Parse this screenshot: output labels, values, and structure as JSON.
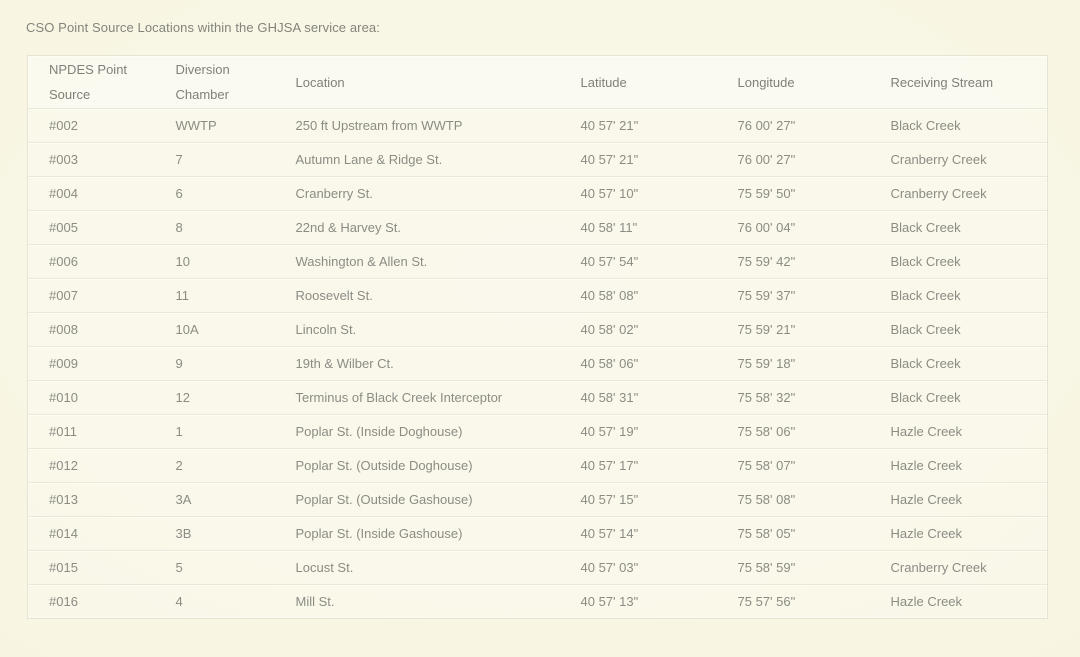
{
  "page": {
    "title": "CSO Point Source Locations within the GHJSA service area:"
  },
  "table": {
    "columns": [
      {
        "label": "NPDES Point Source"
      },
      {
        "label": "Diversion Chamber"
      },
      {
        "label": "Location"
      },
      {
        "label": "Latitude"
      },
      {
        "label": "Longitude"
      },
      {
        "label": "Receiving Stream"
      }
    ],
    "rows": [
      {
        "npdes": "#002",
        "chamber": "WWTP",
        "location": "250 ft Upstream from WWTP",
        "latitude": "40 57' 21\"",
        "longitude": "76 00' 27\"",
        "stream": "Black Creek"
      },
      {
        "npdes": "#003",
        "chamber": "7",
        "location": "Autumn Lane & Ridge St.",
        "latitude": "40 57' 21\"",
        "longitude": "76 00' 27\"",
        "stream": "Cranberry Creek"
      },
      {
        "npdes": "#004",
        "chamber": "6",
        "location": "Cranberry St.",
        "latitude": "40 57' 10\"",
        "longitude": "75 59' 50\"",
        "stream": "Cranberry Creek"
      },
      {
        "npdes": "#005",
        "chamber": "8",
        "location": "22nd & Harvey St.",
        "latitude": "40 58' 11\"",
        "longitude": "76 00' 04\"",
        "stream": "Black Creek"
      },
      {
        "npdes": "#006",
        "chamber": "10",
        "location": "Washington & Allen St.",
        "latitude": "40 57' 54\"",
        "longitude": "75 59' 42\"",
        "stream": "Black Creek"
      },
      {
        "npdes": "#007",
        "chamber": "11",
        "location": "Roosevelt St.",
        "latitude": "40 58' 08\"",
        "longitude": "75 59' 37\"",
        "stream": "Black Creek"
      },
      {
        "npdes": "#008",
        "chamber": "10A",
        "location": "Lincoln St.",
        "latitude": "40 58' 02\"",
        "longitude": "75 59' 21\"",
        "stream": "Black Creek"
      },
      {
        "npdes": "#009",
        "chamber": "9",
        "location": "19th & Wilber Ct.",
        "latitude": "40 58' 06\"",
        "longitude": "75 59' 18\"",
        "stream": "Black Creek"
      },
      {
        "npdes": "#010",
        "chamber": "12",
        "location": "Terminus of Black Creek Interceptor",
        "latitude": "40 58' 31\"",
        "longitude": "75 58' 32\"",
        "stream": "Black Creek"
      },
      {
        "npdes": "#011",
        "chamber": "1",
        "location": "Poplar St. (Inside Doghouse)",
        "latitude": "40 57' 19\"",
        "longitude": "75 58' 06\"",
        "stream": "Hazle Creek"
      },
      {
        "npdes": "#012",
        "chamber": "2",
        "location": "Poplar St. (Outside Doghouse)",
        "latitude": "40 57' 17\"",
        "longitude": "75 58' 07\"",
        "stream": "Hazle Creek"
      },
      {
        "npdes": "#013",
        "chamber": "3A",
        "location": "Poplar St. (Outside Gashouse)",
        "latitude": "40 57' 15\"",
        "longitude": "75 58' 08\"",
        "stream": "Hazle Creek"
      },
      {
        "npdes": "#014",
        "chamber": "3B",
        "location": "Poplar St. (Inside Gashouse)",
        "latitude": "40 57' 14\"",
        "longitude": "75 58' 05\"",
        "stream": "Hazle Creek"
      },
      {
        "npdes": "#015",
        "chamber": "5",
        "location": "Locust St.",
        "latitude": "40 57' 03\"",
        "longitude": "75 58' 59\"",
        "stream": "Cranberry Creek"
      },
      {
        "npdes": "#016",
        "chamber": "4",
        "location": "Mill St.",
        "latitude": "40 57' 13\"",
        "longitude": "75 57' 56\"",
        "stream": "Hazle Creek"
      }
    ]
  },
  "colors": {
    "page_background": "#f8f5e2",
    "table_background": "#faf8ea",
    "border": "#e6e3d3",
    "text": "#8c8c85",
    "header_text": "#80807a"
  }
}
